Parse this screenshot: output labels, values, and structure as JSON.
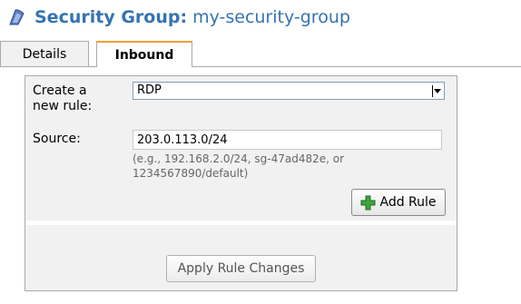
{
  "header": {
    "label": "Security Group:",
    "value": "my-security-group",
    "icon": "security-group-icon",
    "color": "#3573b0"
  },
  "tabs": [
    {
      "label": "Details",
      "active": false
    },
    {
      "label": "Inbound",
      "active": true
    }
  ],
  "form": {
    "create_label_line1": "Create a",
    "create_label_line2": "new rule:",
    "rule_selected": "RDP",
    "source_label": "Source:",
    "source_value": "203.0.113.0/24",
    "hint_line1": "(e.g., 192.168.2.0/24, sg-47ad482e, or",
    "hint_line2": "1234567890/default)",
    "add_rule_label": "Add Rule",
    "apply_label": "Apply Rule Changes"
  }
}
